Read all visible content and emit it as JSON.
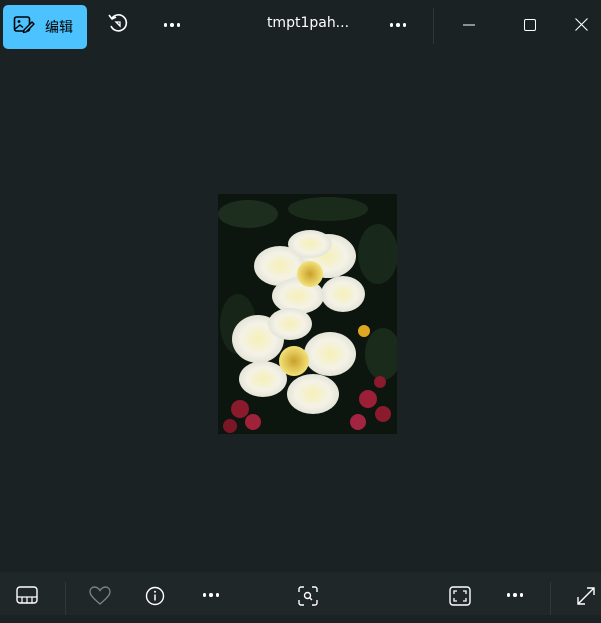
{
  "toolbar": {
    "edit_label": "编辑",
    "file_name": "tmpt1pah..."
  },
  "icons": {
    "edit": "image-edit-icon",
    "rotate": "rotate-icon",
    "more_left": "more-options-icon",
    "more_title": "more-options-icon",
    "minimize": "minimize-icon",
    "maximize": "maximize-icon",
    "close": "close-icon",
    "filmstrip": "filmstrip-icon",
    "favorite": "heart-icon",
    "info": "info-icon",
    "more_bottom_left": "more-options-icon",
    "visual_search": "visual-search-icon",
    "fit": "fit-to-window-icon",
    "more_bottom_right": "more-options-icon",
    "fullscreen": "fullscreen-icon"
  },
  "colors": {
    "accent": "#4cc2ff",
    "background": "#1b2224",
    "bottom_bar": "#202729"
  }
}
